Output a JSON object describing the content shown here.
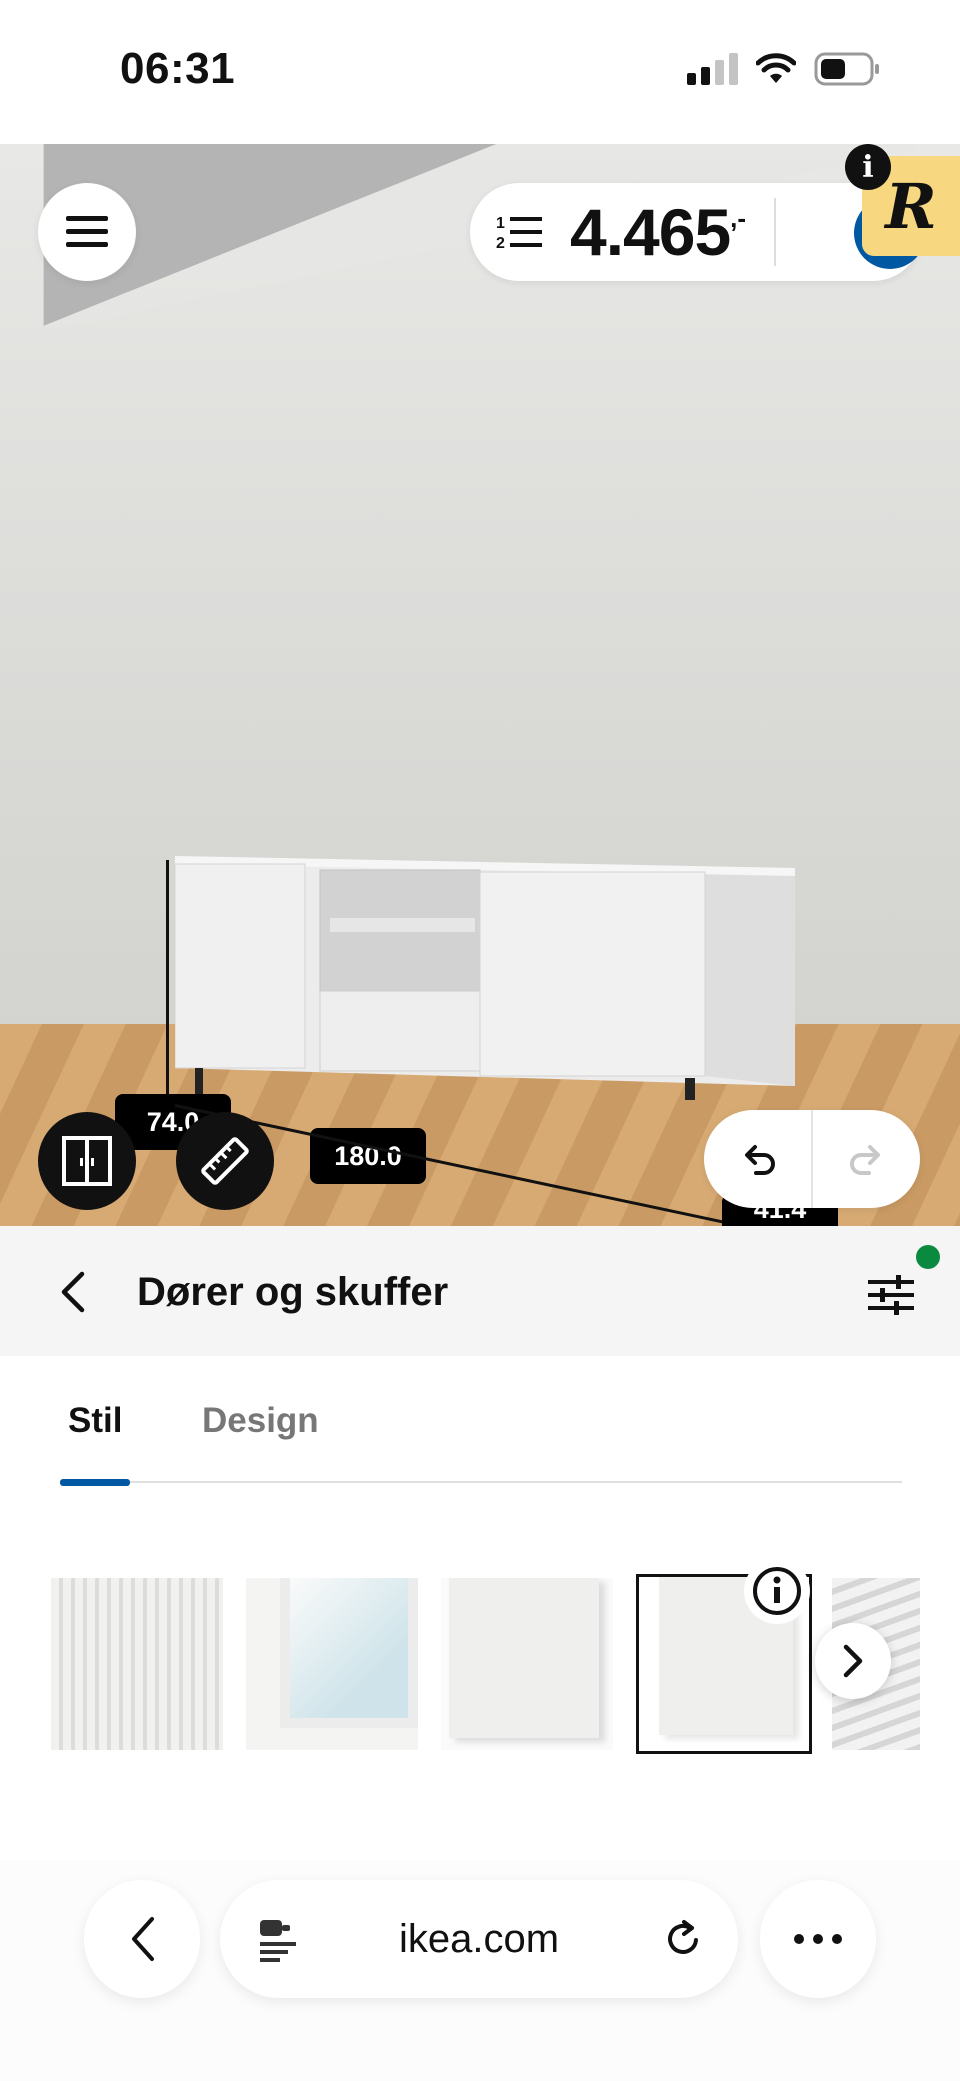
{
  "status_bar": {
    "time": "06:31",
    "signal_bars_active": 2,
    "signal_bars_total": 4,
    "icons": [
      "signal-icon",
      "wifi-icon",
      "battery-icon"
    ]
  },
  "scene": {
    "height_label": "74.0",
    "width_label": "180.0",
    "depth_label": "41.4",
    "price": {
      "value": "4.465",
      "suffix": ",-"
    },
    "extension_badge_letter": "R",
    "info_letter": "i"
  },
  "panel": {
    "title": "Dører og skuffer",
    "tabs": [
      {
        "label": "Stil",
        "active": true
      },
      {
        "label": "Design",
        "active": false
      }
    ],
    "selected_swatch": 4,
    "filter_active_color": "#0a8a3f"
  },
  "browser": {
    "url": "ikea.com"
  },
  "colors": {
    "accent": "#0058a3",
    "badge": "#f7d77f",
    "status_dot": "#0a8a3f"
  }
}
